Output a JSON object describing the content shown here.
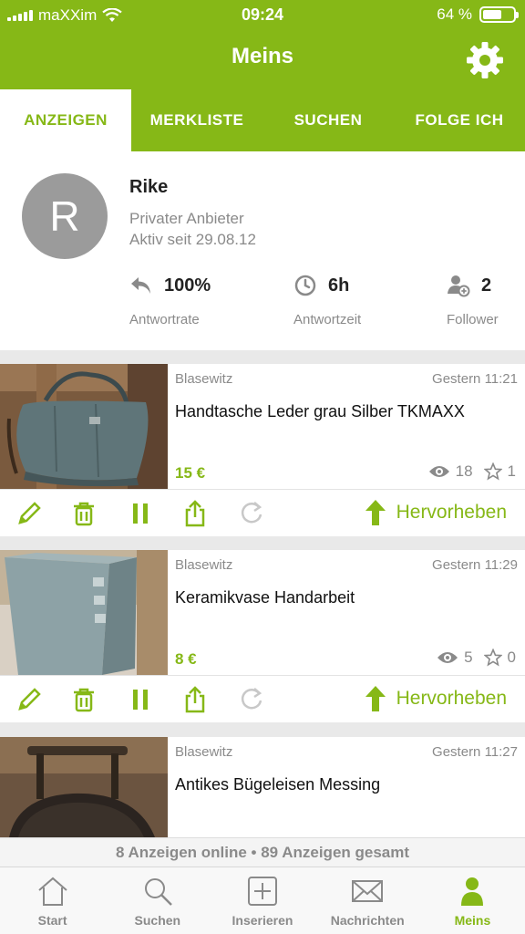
{
  "status_bar": {
    "carrier": "maXXim",
    "time": "09:24",
    "battery": "64 %",
    "battery_level": 0.64
  },
  "header": {
    "title": "Meins",
    "settings_icon": "gear-icon"
  },
  "tabs": [
    {
      "label": "ANZEIGEN",
      "active": true
    },
    {
      "label": "MERKLISTE",
      "active": false
    },
    {
      "label": "SUCHEN",
      "active": false
    },
    {
      "label": "FOLGE ICH",
      "active": false
    }
  ],
  "profile": {
    "initial": "R",
    "name": "Rike",
    "type": "Privater Anbieter",
    "since": "Aktiv seit 29.08.12",
    "stats": [
      {
        "icon": "reply-icon",
        "value": "100%",
        "label": "Antwortrate"
      },
      {
        "icon": "clock-icon",
        "value": "6h",
        "label": "Antwortzeit"
      },
      {
        "icon": "follower-icon",
        "value": "2",
        "label": "Follower"
      }
    ]
  },
  "listings": [
    {
      "location": "Blasewitz",
      "date": "Gestern 11:21",
      "title": "Handtasche Leder grau Silber TKMAXX",
      "price": "15 €",
      "views": "18",
      "watches": "1",
      "promote_label": "Hervorheben"
    },
    {
      "location": "Blasewitz",
      "date": "Gestern 11:29",
      "title": "Keramikvase Handarbeit",
      "price": "8 €",
      "views": "5",
      "watches": "0",
      "promote_label": "Hervorheben"
    },
    {
      "location": "Blasewitz",
      "date": "Gestern 11:27",
      "title": "Antikes Bügeleisen Messing"
    }
  ],
  "summary": "8 Anzeigen online • 89 Anzeigen gesamt",
  "bottom_nav": [
    {
      "label": "Start",
      "icon": "home-icon",
      "active": false
    },
    {
      "label": "Suchen",
      "icon": "search-icon",
      "active": false
    },
    {
      "label": "Inserieren",
      "icon": "add-icon",
      "active": false
    },
    {
      "label": "Nachrichten",
      "icon": "mail-icon",
      "active": false
    },
    {
      "label": "Meins",
      "icon": "person-icon",
      "active": true
    }
  ],
  "colors": {
    "accent": "#86b817",
    "muted": "#8a8a8a"
  }
}
